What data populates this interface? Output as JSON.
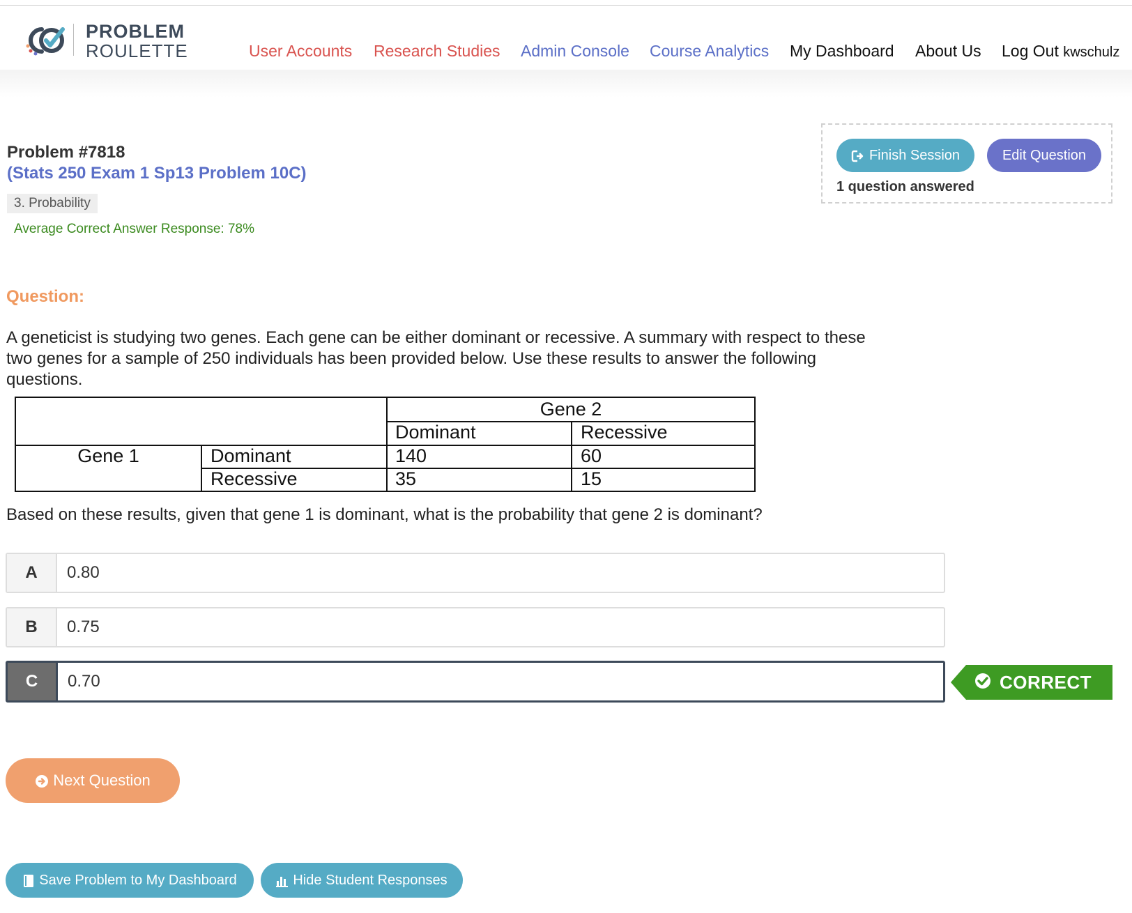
{
  "app": {
    "logo_line1": "PROBLEM",
    "logo_line2": "ROULETTE",
    "colors": {
      "nav_red": "#d9534f",
      "nav_blue": "#5b6fc7",
      "accent_teal": "#55abc5",
      "accent_orange": "#f0a06e",
      "correct_green": "#3e9b23"
    }
  },
  "nav": {
    "user_accounts": "User Accounts",
    "research_studies": "Research Studies",
    "admin_console": "Admin Console",
    "course_analytics": "Course Analytics",
    "my_dashboard": "My Dashboard",
    "about_us": "About Us",
    "log_out": "Log Out",
    "username": "kwschulz"
  },
  "session": {
    "finish_label": "Finish Session",
    "edit_label": "Edit Question",
    "answered_text": "1 question answered"
  },
  "problem": {
    "title": "Problem #7818",
    "subtitle": "(Stats 250 Exam 1 Sp13 Problem 10C)",
    "topic": "3. Probability",
    "avg_response": "Average Correct Answer Response: 78%"
  },
  "question": {
    "label": "Question:",
    "text": "A geneticist is studying two genes. Each gene can be either dominant or recessive. A summary with respect to these two genes for a sample of 250 individuals has been provided below. Use these results to answer the following questions.",
    "table": {
      "gene2_header": "Gene 2",
      "col_dominant": "Dominant",
      "col_recessive": "Recessive",
      "gene1_label": "Gene 1",
      "row_dominant": "Dominant",
      "row_recessive": "Recessive",
      "dd": "140",
      "dr": "60",
      "rd": "35",
      "rr": "15"
    },
    "prompt": "Based on these results, given that gene 1 is dominant, what is the probability that gene 2 is dominant?"
  },
  "choices": [
    {
      "letter": "A",
      "value": "0.80"
    },
    {
      "letter": "B",
      "value": "0.75"
    },
    {
      "letter": "C",
      "value": "0.70"
    }
  ],
  "result": {
    "label": "CORRECT",
    "icon": "check-circle-icon"
  },
  "actions": {
    "next_label": "Next Question",
    "save_label": "Save Problem to My Dashboard",
    "hide_label": "Hide Student Responses"
  }
}
